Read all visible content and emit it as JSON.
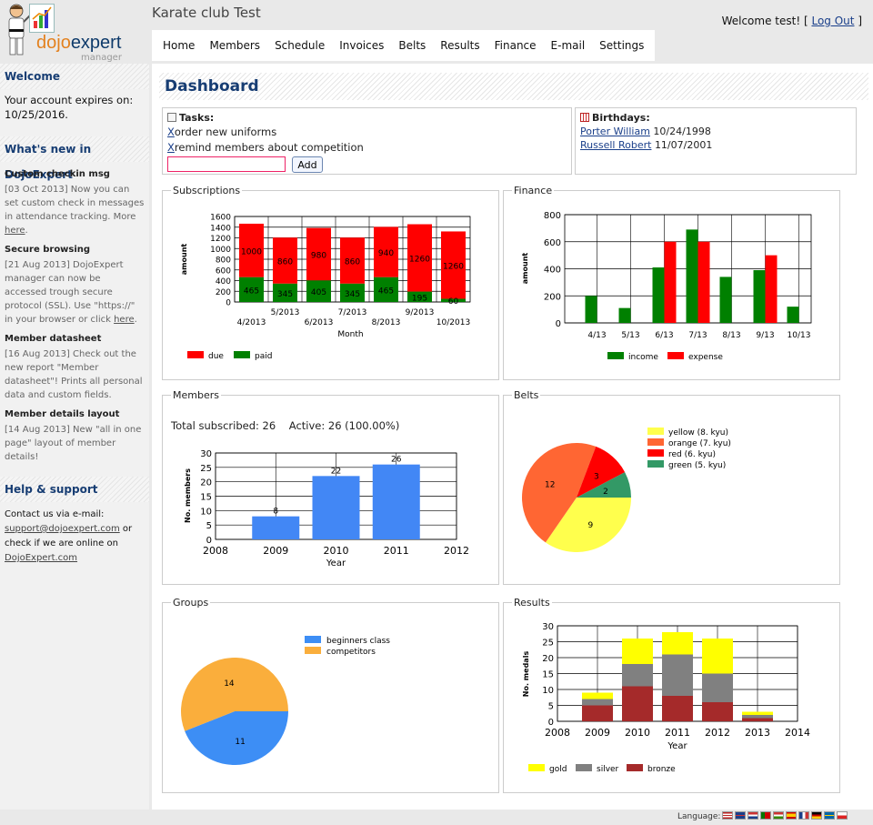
{
  "header": {
    "logo": {
      "brand_part1": "dojo",
      "brand_part2": "expert",
      "sub": "manager"
    },
    "club_title": "Karate club Test",
    "welcome_prefix": "Welcome test! [",
    "logout_label": "Log Out",
    "welcome_suffix": "]"
  },
  "nav": [
    "Home",
    "Members",
    "Schedule",
    "Invoices",
    "Belts",
    "Results",
    "Finance",
    "E-mail",
    "Settings"
  ],
  "sidebar": {
    "welcome_title": "Welcome",
    "expiry_text": "Your account expires on: 10/25/2016.",
    "news_title": "What's new in DojoExpert",
    "news": [
      {
        "title": "Custom checkin msg",
        "body": "[03 Oct 2013] Now you can set custom check in messages in attendance tracking. More ",
        "link": "here",
        "tail": "."
      },
      {
        "title": "Secure browsing",
        "body": "[21 Aug 2013] DojoExpert manager can now be accessed trough secure protocol (SSL). Use \"https://\" in your browser or click ",
        "link": "here",
        "tail": "."
      },
      {
        "title": "Member datasheet",
        "body": "[16 Aug 2013] Check out the new report \"Member datasheet\"! Prints all personal data and custom fields.",
        "link": "",
        "tail": ""
      },
      {
        "title": "Member details layout",
        "body": "[14 Aug 2013] New \"all in one page\" layout of member details!",
        "link": "",
        "tail": ""
      }
    ],
    "help_title": "Help & support",
    "contact_text": "Contact us via e-mail:",
    "email": "support@dojoexpert.com",
    "or_text": " or check if we are online on ",
    "site": "DojoExpert.com"
  },
  "main": {
    "title": "Dashboard",
    "tasks": {
      "title": "Tasks:",
      "delete_glyph": "X",
      "items": [
        "order new uniforms",
        "remind members about competition"
      ],
      "input_value": "",
      "add_label": "Add"
    },
    "birthdays": {
      "title": "Birthdays:",
      "items": [
        {
          "name": "Porter William",
          "date": "10/24/1998"
        },
        {
          "name": "Russell Robert",
          "date": "11/07/2001"
        }
      ]
    },
    "members": {
      "summary": "Total subscribed: 26    Active: 26 (100.00%)"
    },
    "panels": {
      "subscriptions": "Subscriptions",
      "finance": "Finance",
      "members": "Members",
      "belts": "Belts",
      "groups": "Groups",
      "results": "Results"
    }
  },
  "footer": {
    "language_label": "Language:",
    "flags": [
      "us",
      "uk",
      "hr",
      "pt",
      "hu",
      "es",
      "fr",
      "de",
      "se",
      "pl"
    ]
  },
  "colors": {
    "due": "#ff0000",
    "paid": "#008000",
    "income": "#008000",
    "expense": "#ff0000",
    "bar_blue": "#4287f5",
    "yellow": "#ffff4d",
    "orange": "#ff6633",
    "red": "#ff0000",
    "green": "#339966",
    "beginners": "#3d8ef5",
    "competitors": "#faae3c",
    "gold": "#ffff00",
    "silver": "#808080",
    "bronze": "#a52a2a"
  },
  "chart_data": [
    {
      "id": "subscriptions",
      "type": "bar",
      "xlabel": "Month",
      "ylabel": "amount",
      "categories": [
        "4/2013",
        "5/2013",
        "6/2013",
        "7/2013",
        "8/2013",
        "9/2013",
        "10/2013"
      ],
      "ylim": [
        0,
        1600
      ],
      "yticks": [
        0,
        200,
        400,
        600,
        800,
        1000,
        1200,
        1400,
        1600
      ],
      "series": [
        {
          "name": "paid",
          "values": [
            465,
            345,
            405,
            345,
            465,
            195,
            60
          ],
          "labels": [
            "465",
            "345",
            "405",
            "345",
            "465",
            "195",
            "60"
          ]
        },
        {
          "name": "due",
          "values": [
            1000,
            860,
            980,
            860,
            940,
            1260,
            1260
          ],
          "labels": [
            "1000",
            "860",
            "980",
            "860",
            "940",
            "1260",
            "1260"
          ]
        }
      ]
    },
    {
      "id": "finance",
      "type": "bar",
      "ylabel": "amount",
      "categories": [
        "4/13",
        "5/13",
        "6/13",
        "7/13",
        "8/13",
        "9/13",
        "10/13"
      ],
      "ylim": [
        0,
        800
      ],
      "yticks": [
        0,
        200,
        400,
        600,
        800
      ],
      "series": [
        {
          "name": "income",
          "values": [
            200,
            110,
            410,
            690,
            340,
            390,
            120
          ]
        },
        {
          "name": "expense",
          "values": [
            0,
            0,
            600,
            600,
            0,
            500,
            0
          ]
        }
      ]
    },
    {
      "id": "members",
      "type": "bar",
      "xlabel": "Year",
      "ylabel": "No. members",
      "x": [
        2008,
        2009,
        2010,
        2011,
        2012
      ],
      "xlim": [
        2008,
        2012
      ],
      "ylim": [
        0,
        30
      ],
      "yticks": [
        0,
        5,
        10,
        15,
        20,
        25,
        30
      ],
      "values": [
        {
          "x": 2009,
          "y": 8,
          "label": "8"
        },
        {
          "x": 2010,
          "y": 22,
          "label": "22"
        },
        {
          "x": 2011,
          "y": 26,
          "label": "26"
        }
      ]
    },
    {
      "id": "belts",
      "type": "pie",
      "slices": [
        {
          "label": "yellow (8. kyu)",
          "value": 9
        },
        {
          "label": "orange (7. kyu)",
          "value": 12
        },
        {
          "label": "red (6. kyu)",
          "value": 3
        },
        {
          "label": "green (5. kyu)",
          "value": 2
        }
      ]
    },
    {
      "id": "groups",
      "type": "pie",
      "slices": [
        {
          "label": "beginners class",
          "value": 11
        },
        {
          "label": "competitors",
          "value": 14
        }
      ]
    },
    {
      "id": "results",
      "type": "bar",
      "xlabel": "Year",
      "ylabel": "No. medals",
      "x": [
        2008,
        2009,
        2010,
        2011,
        2012,
        2013,
        2014
      ],
      "categories": [
        2009,
        2010,
        2011,
        2012,
        2013
      ],
      "ylim": [
        0,
        30
      ],
      "yticks": [
        0,
        5,
        10,
        15,
        20,
        25,
        30
      ],
      "series": [
        {
          "name": "bronze",
          "values": [
            5,
            11,
            8,
            6,
            1
          ]
        },
        {
          "name": "silver",
          "values": [
            2,
            7,
            13,
            9,
            1
          ]
        },
        {
          "name": "gold",
          "values": [
            2,
            8,
            7,
            11,
            1
          ]
        }
      ]
    }
  ]
}
